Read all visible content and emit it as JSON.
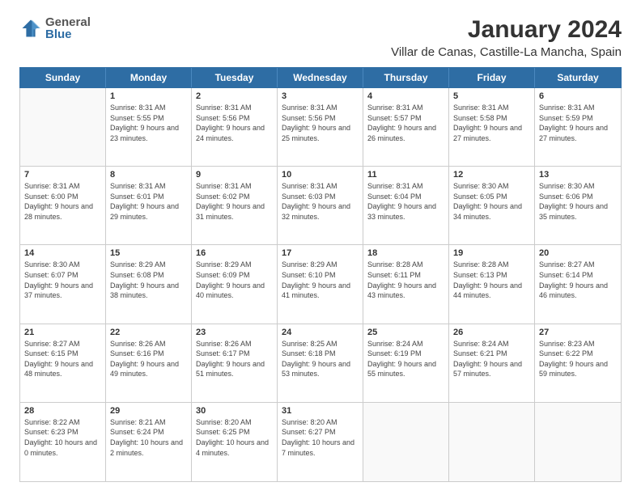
{
  "logo": {
    "general": "General",
    "blue": "Blue"
  },
  "title": "January 2024",
  "subtitle": "Villar de Canas, Castille-La Mancha, Spain",
  "header": {
    "days": [
      "Sunday",
      "Monday",
      "Tuesday",
      "Wednesday",
      "Thursday",
      "Friday",
      "Saturday"
    ]
  },
  "weeks": [
    [
      {
        "day": "",
        "empty": true
      },
      {
        "day": "1",
        "sunrise": "8:31 AM",
        "sunset": "5:55 PM",
        "daylight": "9 hours and 23 minutes."
      },
      {
        "day": "2",
        "sunrise": "8:31 AM",
        "sunset": "5:56 PM",
        "daylight": "9 hours and 24 minutes."
      },
      {
        "day": "3",
        "sunrise": "8:31 AM",
        "sunset": "5:56 PM",
        "daylight": "9 hours and 25 minutes."
      },
      {
        "day": "4",
        "sunrise": "8:31 AM",
        "sunset": "5:57 PM",
        "daylight": "9 hours and 26 minutes."
      },
      {
        "day": "5",
        "sunrise": "8:31 AM",
        "sunset": "5:58 PM",
        "daylight": "9 hours and 27 minutes."
      },
      {
        "day": "6",
        "sunrise": "8:31 AM",
        "sunset": "5:59 PM",
        "daylight": "9 hours and 27 minutes."
      }
    ],
    [
      {
        "day": "7",
        "sunrise": "8:31 AM",
        "sunset": "6:00 PM",
        "daylight": "9 hours and 28 minutes."
      },
      {
        "day": "8",
        "sunrise": "8:31 AM",
        "sunset": "6:01 PM",
        "daylight": "9 hours and 29 minutes."
      },
      {
        "day": "9",
        "sunrise": "8:31 AM",
        "sunset": "6:02 PM",
        "daylight": "9 hours and 31 minutes."
      },
      {
        "day": "10",
        "sunrise": "8:31 AM",
        "sunset": "6:03 PM",
        "daylight": "9 hours and 32 minutes."
      },
      {
        "day": "11",
        "sunrise": "8:31 AM",
        "sunset": "6:04 PM",
        "daylight": "9 hours and 33 minutes."
      },
      {
        "day": "12",
        "sunrise": "8:30 AM",
        "sunset": "6:05 PM",
        "daylight": "9 hours and 34 minutes."
      },
      {
        "day": "13",
        "sunrise": "8:30 AM",
        "sunset": "6:06 PM",
        "daylight": "9 hours and 35 minutes."
      }
    ],
    [
      {
        "day": "14",
        "sunrise": "8:30 AM",
        "sunset": "6:07 PM",
        "daylight": "9 hours and 37 minutes."
      },
      {
        "day": "15",
        "sunrise": "8:29 AM",
        "sunset": "6:08 PM",
        "daylight": "9 hours and 38 minutes."
      },
      {
        "day": "16",
        "sunrise": "8:29 AM",
        "sunset": "6:09 PM",
        "daylight": "9 hours and 40 minutes."
      },
      {
        "day": "17",
        "sunrise": "8:29 AM",
        "sunset": "6:10 PM",
        "daylight": "9 hours and 41 minutes."
      },
      {
        "day": "18",
        "sunrise": "8:28 AM",
        "sunset": "6:11 PM",
        "daylight": "9 hours and 43 minutes."
      },
      {
        "day": "19",
        "sunrise": "8:28 AM",
        "sunset": "6:13 PM",
        "daylight": "9 hours and 44 minutes."
      },
      {
        "day": "20",
        "sunrise": "8:27 AM",
        "sunset": "6:14 PM",
        "daylight": "9 hours and 46 minutes."
      }
    ],
    [
      {
        "day": "21",
        "sunrise": "8:27 AM",
        "sunset": "6:15 PM",
        "daylight": "9 hours and 48 minutes."
      },
      {
        "day": "22",
        "sunrise": "8:26 AM",
        "sunset": "6:16 PM",
        "daylight": "9 hours and 49 minutes."
      },
      {
        "day": "23",
        "sunrise": "8:26 AM",
        "sunset": "6:17 PM",
        "daylight": "9 hours and 51 minutes."
      },
      {
        "day": "24",
        "sunrise": "8:25 AM",
        "sunset": "6:18 PM",
        "daylight": "9 hours and 53 minutes."
      },
      {
        "day": "25",
        "sunrise": "8:24 AM",
        "sunset": "6:19 PM",
        "daylight": "9 hours and 55 minutes."
      },
      {
        "day": "26",
        "sunrise": "8:24 AM",
        "sunset": "6:21 PM",
        "daylight": "9 hours and 57 minutes."
      },
      {
        "day": "27",
        "sunrise": "8:23 AM",
        "sunset": "6:22 PM",
        "daylight": "9 hours and 59 minutes."
      }
    ],
    [
      {
        "day": "28",
        "sunrise": "8:22 AM",
        "sunset": "6:23 PM",
        "daylight": "10 hours and 0 minutes."
      },
      {
        "day": "29",
        "sunrise": "8:21 AM",
        "sunset": "6:24 PM",
        "daylight": "10 hours and 2 minutes."
      },
      {
        "day": "30",
        "sunrise": "8:20 AM",
        "sunset": "6:25 PM",
        "daylight": "10 hours and 4 minutes."
      },
      {
        "day": "31",
        "sunrise": "8:20 AM",
        "sunset": "6:27 PM",
        "daylight": "10 hours and 7 minutes."
      },
      {
        "day": "",
        "empty": true
      },
      {
        "day": "",
        "empty": true
      },
      {
        "day": "",
        "empty": true
      }
    ]
  ]
}
